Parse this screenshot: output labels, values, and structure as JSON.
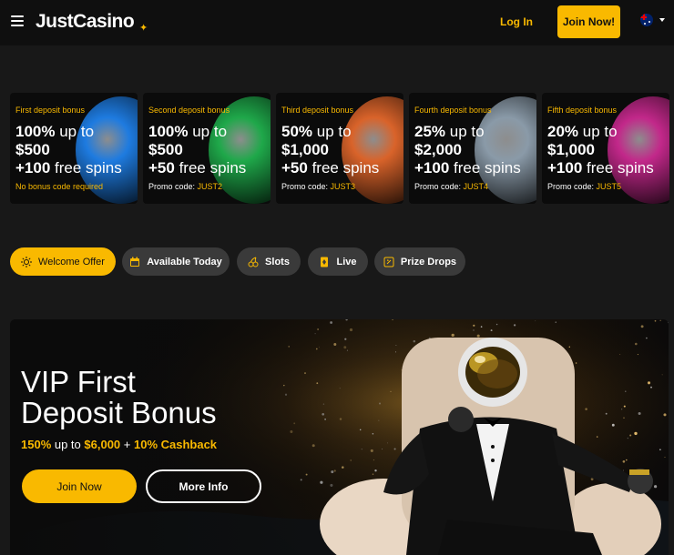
{
  "header": {
    "logo": "JustCasino",
    "login_label": "Log In",
    "join_label": "Join Now!",
    "flag_icon": "australia-flag-icon"
  },
  "bonus_cards": [
    {
      "title": "First deposit bonus",
      "line1_bold": "100%",
      "line1_rest": " up to",
      "line2": "$500",
      "line3_bold": "+100",
      "line3_rest": " free spins",
      "note_prefix": "No bonus code required",
      "code": "",
      "planet_color": "#1e7be0"
    },
    {
      "title": "Second deposit bonus",
      "line1_bold": "100%",
      "line1_rest": " up to",
      "line2": "$500",
      "line3_bold": "+50",
      "line3_rest": " free spins",
      "note_prefix": "Promo code: ",
      "code": "JUST2",
      "planet_color": "#1fa84a"
    },
    {
      "title": "Third deposit bonus",
      "line1_bold": "50%",
      "line1_rest": " up to",
      "line2": "$1,000",
      "line3_bold": "+50",
      "line3_rest": " free spins",
      "note_prefix": "Promo code: ",
      "code": "JUST3",
      "planet_color": "#d9632a"
    },
    {
      "title": "Fourth deposit bonus",
      "line1_bold": "25%",
      "line1_rest": " up to",
      "line2": "$2,000",
      "line3_bold": "+100",
      "line3_rest": " free spins",
      "note_prefix": "Promo code: ",
      "code": "JUST4",
      "planet_color": "#8a9aa8"
    },
    {
      "title": "Fifth deposit bonus",
      "line1_bold": "20%",
      "line1_rest": " up to",
      "line2": "$1,000",
      "line3_bold": "+100",
      "line3_rest": " free spins",
      "note_prefix": "Promo code: ",
      "code": "JUST5",
      "planet_color": "#c2288a"
    }
  ],
  "filters": [
    {
      "label": "Welcome Offer",
      "icon": "sun-icon",
      "active": true
    },
    {
      "label": "Available Today",
      "icon": "calendar-icon",
      "active": false
    },
    {
      "label": "Slots",
      "icon": "cherries-icon",
      "active": false
    },
    {
      "label": "Live",
      "icon": "card-icon",
      "active": false
    },
    {
      "label": "Prize Drops",
      "icon": "prize-icon",
      "active": false
    }
  ],
  "hero": {
    "title_line1": "VIP First",
    "title_line2": "Deposit Bonus",
    "sub_pct": "150%",
    "sub_mid1": " up to ",
    "sub_amount": "$6,000",
    "sub_mid2": " + ",
    "sub_cashback": "10% Cashback",
    "join_label": "Join Now",
    "more_label": "More Info"
  },
  "colors": {
    "accent": "#f9b900",
    "background": "#181818",
    "chip": "#3a3a3a"
  }
}
